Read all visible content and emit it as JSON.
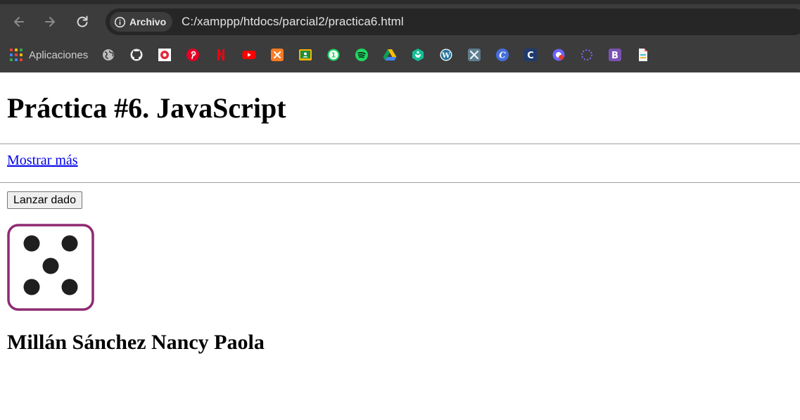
{
  "browser": {
    "site_chip_label": "Archivo",
    "url": "C:/xamppp/htdocs/parcial2/practica6.html",
    "bookmarks_apps_label": "Aplicaciones",
    "bookmark_icons": [
      "globe-icon",
      "github-icon",
      "record-icon",
      "pinterest-icon",
      "netflix-icon",
      "youtube-icon",
      "xampp-icon",
      "classroom-icon",
      "whatsapp-icon",
      "spotify-icon",
      "drive-icon",
      "khan-icon",
      "wordpress-icon",
      "tools-icon",
      "canva-icon",
      "c-icon",
      "chrome-app-icon",
      "dots-icon",
      "bootstrap-icon",
      "file-icon"
    ]
  },
  "page": {
    "title": "Práctica #6. JavaScript",
    "link_label": "Mostrar más",
    "button_label": "Lanzar dado",
    "dice_value": 5,
    "author": "Millán Sánchez Nancy Paola"
  }
}
